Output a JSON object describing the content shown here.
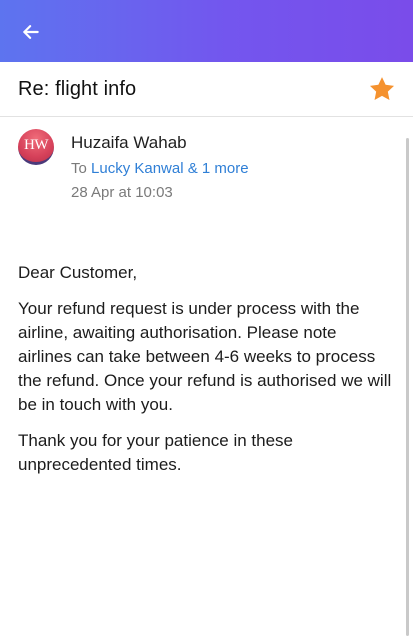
{
  "header": {
    "back_icon": "arrow-left-icon",
    "gradient_start": "#5d74ef",
    "gradient_end": "#7a4cea"
  },
  "email": {
    "subject": "Re: flight info",
    "starred": true,
    "star_color": "#f5922f",
    "sender": {
      "name": "Huzaifa Wahab",
      "avatar_initials": "HW"
    },
    "recipients": {
      "prefix": "To",
      "names": "Lucky Kanwal & 1 more"
    },
    "date": "28 Apr at 10:03",
    "body": {
      "greeting": "Dear Customer,",
      "paragraph1": "Your refund request is under process  with the airline, awaiting authorisation. Please note airlines can take between 4-6 weeks to process the refund. Once your refund is authorised we will be in touch with you.",
      "paragraph2": "Thank you for your patience in these unprecedented times."
    }
  }
}
